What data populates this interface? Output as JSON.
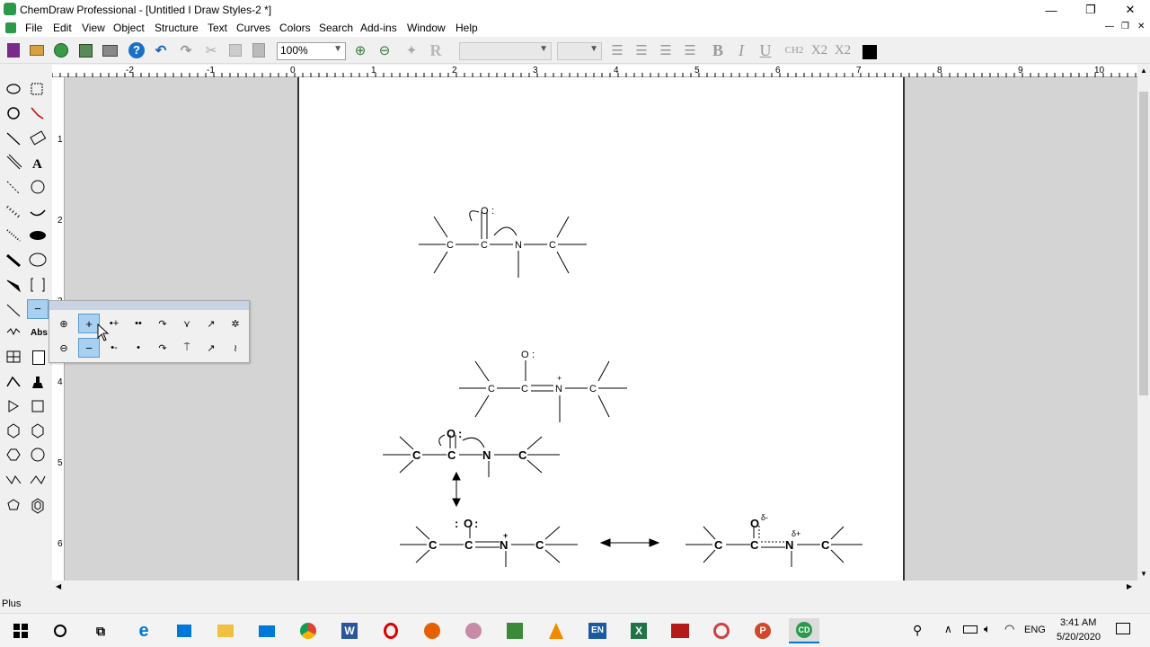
{
  "window": {
    "title": "ChemDraw Professional - [Untitled I Draw Styles-2 *]",
    "controls": [
      "—",
      "❐",
      "✕"
    ]
  },
  "menu": {
    "items": [
      "File",
      "Edit",
      "View",
      "Object",
      "Structure",
      "Text",
      "Curves",
      "Colors",
      "Search",
      "Add-ins",
      "Window",
      "Help"
    ]
  },
  "toolbar": {
    "zoom": "100%",
    "bold": "B",
    "italic": "I",
    "underline": "U",
    "ch2": "CH2",
    "x2_sub": "X2",
    "x2_sup": "X2",
    "r_icon": "R"
  },
  "palette": {
    "text_tool": "A",
    "abs_label": "Abs",
    "popup_plus": "+",
    "popup_minus": "−"
  },
  "ruler": {
    "h_labels": [
      "-2",
      "-1",
      "0",
      "1",
      "2",
      "3",
      "4",
      "5",
      "6",
      "7",
      "8",
      "9",
      "10"
    ],
    "v_labels": [
      "1",
      "2",
      "3",
      "4",
      "5",
      "6"
    ]
  },
  "status": {
    "text": "Plus"
  },
  "taskbar": {
    "time": "3:41 AM",
    "date": "5/20/2020",
    "lang": "ENG"
  },
  "chem": {
    "C": "C",
    "N": "N",
    "O": "O",
    "plus": "+",
    "delta_minus": "δ-",
    "delta_plus": "δ+"
  },
  "colors": {
    "accent": "#0078d7",
    "selected": "#a8d0f0",
    "page_border": "#333333"
  }
}
